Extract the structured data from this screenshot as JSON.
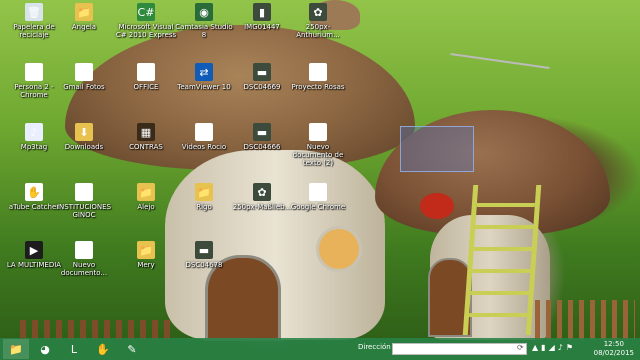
{
  "desktop_icons": [
    {
      "label": "Papelera de reciclaje",
      "icon": "recycle-bin-icon",
      "glyph": "🗑"
    },
    {
      "label": "Angela",
      "icon": "folder-icon",
      "glyph": "📁"
    },
    {
      "label": "Microsoft Visual C# 2010 Express",
      "icon": "visual-studio-icon",
      "glyph": "C#"
    },
    {
      "label": "Camtasia Studio 8",
      "icon": "camtasia-icon",
      "glyph": "◉"
    },
    {
      "label": "IMG01447",
      "icon": "image-icon",
      "glyph": "▮"
    },
    {
      "label": "250px-Anthurium...",
      "icon": "image-icon",
      "glyph": "✿"
    },
    {
      "label": "Persona 2 - Chrome",
      "icon": "chrome-icon",
      "glyph": "◕"
    },
    {
      "label": "Gmail Fotos",
      "icon": "google-photos-icon",
      "glyph": "⟳"
    },
    {
      "label": "OFFICE",
      "icon": "word-document-icon",
      "glyph": "W"
    },
    {
      "label": "TeamViewer 10",
      "icon": "teamviewer-icon",
      "glyph": "⇄"
    },
    {
      "label": "DSC04669",
      "icon": "image-icon",
      "glyph": "▬"
    },
    {
      "label": "Proyecto Rosas",
      "icon": "word-document-icon",
      "glyph": "W"
    },
    {
      "label": "Mp3tag",
      "icon": "mp3tag-icon",
      "glyph": "♪"
    },
    {
      "label": "Downloads",
      "icon": "folder-icon",
      "glyph": "⬇"
    },
    {
      "label": "CONTRAS",
      "icon": "contras-icon",
      "glyph": "▦"
    },
    {
      "label": "Videos Rocio",
      "icon": "document-icon",
      "glyph": "▤"
    },
    {
      "label": "DSC04666",
      "icon": "image-icon",
      "glyph": "▬"
    },
    {
      "label": "Nuevo documento de texto (2)",
      "icon": "text-document-icon",
      "glyph": "▤"
    },
    {
      "label": "aTube Catcher",
      "icon": "atube-catcher-icon",
      "glyph": "✋"
    },
    {
      "label": "INSTITUCIONES GINOC",
      "icon": "word-document-icon",
      "glyph": "W"
    },
    {
      "label": "Alejo",
      "icon": "folder-icon",
      "glyph": "📁"
    },
    {
      "label": "Rigo",
      "icon": "folder-icon",
      "glyph": "📁"
    },
    {
      "label": "250px-Maßlieb...",
      "icon": "image-icon",
      "glyph": "✿"
    },
    {
      "label": "Google Chrome",
      "icon": "chrome-icon",
      "glyph": "◕"
    },
    {
      "label": "LA MULTIMEDIA",
      "icon": "multimedia-icon",
      "glyph": "▶"
    },
    {
      "label": "Nuevo documento...",
      "icon": "text-document-icon",
      "glyph": "▤"
    },
    {
      "label": "Mery",
      "icon": "folder-icon",
      "glyph": "📁"
    },
    {
      "label": "DSC04678",
      "icon": "image-icon",
      "glyph": "▬"
    }
  ],
  "taskbar": {
    "buttons": [
      {
        "name": "file-explorer-icon",
        "glyph": "📁"
      },
      {
        "name": "chrome-icon",
        "glyph": "◕"
      },
      {
        "name": "lync-icon",
        "glyph": "L"
      },
      {
        "name": "atube-catcher-icon",
        "glyph": "✋"
      },
      {
        "name": "notes-icon",
        "glyph": "✎"
      }
    ],
    "address_label": "Dirección",
    "address_value": "",
    "clock_time": "12:50",
    "clock_date": "08/02/2015"
  }
}
